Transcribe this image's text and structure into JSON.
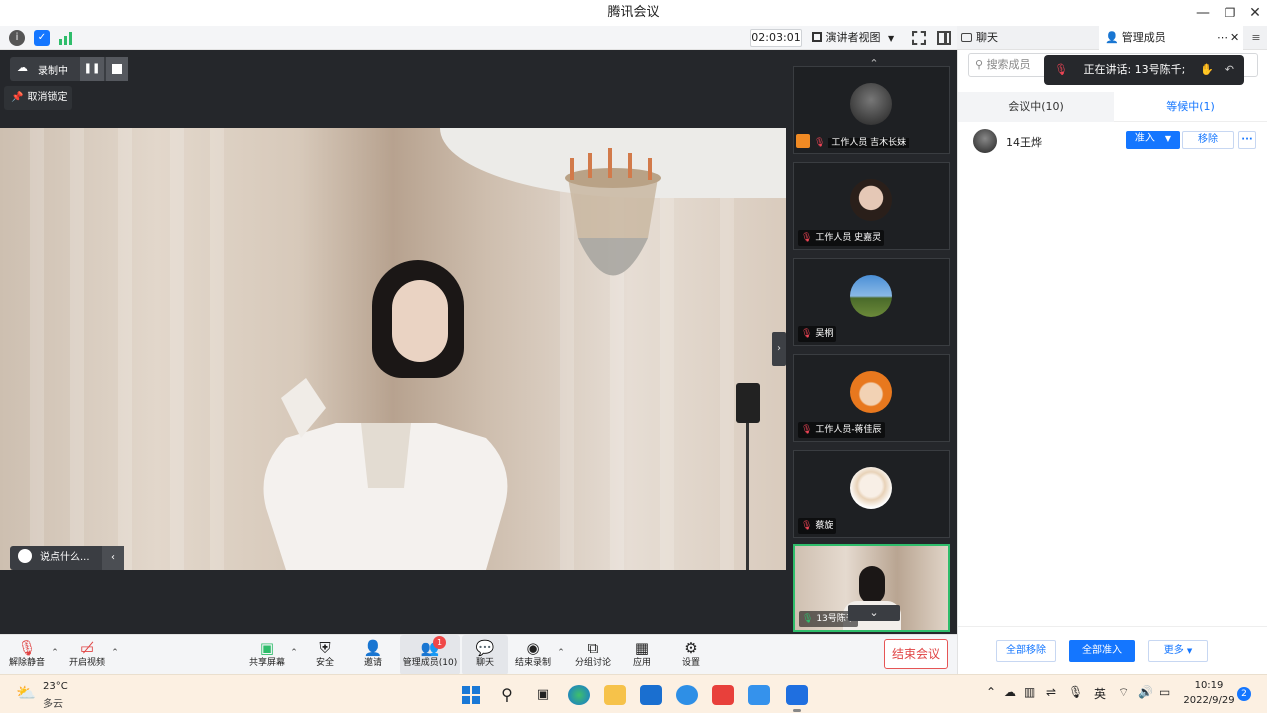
{
  "window": {
    "title": "腾讯会议"
  },
  "toolbar": {
    "timer": "02:03:01",
    "view_label": "演讲者视图"
  },
  "right_tabs": {
    "chat": "聊天",
    "members": "管理成员"
  },
  "recording": {
    "label": "录制中"
  },
  "unlock": {
    "label": "取消锁定"
  },
  "chat_input": {
    "placeholder": "说点什么..."
  },
  "thumbnails": [
    {
      "label": "工作人员 吉木长妹"
    },
    {
      "label": "工作人员 史嘉灵"
    },
    {
      "label": "吴桐"
    },
    {
      "label": "工作人员-蒋佳辰"
    },
    {
      "label": "蔡旋"
    },
    {
      "label": "13号陈千"
    }
  ],
  "members_panel": {
    "search_placeholder": "搜索成员",
    "speaking_text": "正在讲话: 13号陈千;",
    "tab_in_meeting": "会议中(10)",
    "tab_waiting": "等候中(1)",
    "waiting_member": {
      "name": "14王烨",
      "admit": "准入",
      "remove": "移除",
      "more": "···"
    },
    "footer": {
      "remove_all": "全部移除",
      "admit_all": "全部准入",
      "more": "更多"
    }
  },
  "controls": {
    "unmute": "解除静音",
    "start_video": "开启视频",
    "share_screen": "共享屏幕",
    "security": "安全",
    "invite": "邀请",
    "manage_members": "管理成员(10)",
    "members_badge": "1",
    "chat": "聊天",
    "end_recording": "结束录制",
    "breakout": "分组讨论",
    "apps": "应用",
    "settings": "设置",
    "end_meeting": "结束会议"
  },
  "taskbar": {
    "weather_temp": "23°C",
    "weather_desc": "多云",
    "ime": "英",
    "time": "10:19",
    "date": "2022/9/29",
    "notification_count": "2"
  },
  "colors": {
    "accent": "#1476ff",
    "danger": "#e04444",
    "recording_green": "#2fbd6b"
  }
}
